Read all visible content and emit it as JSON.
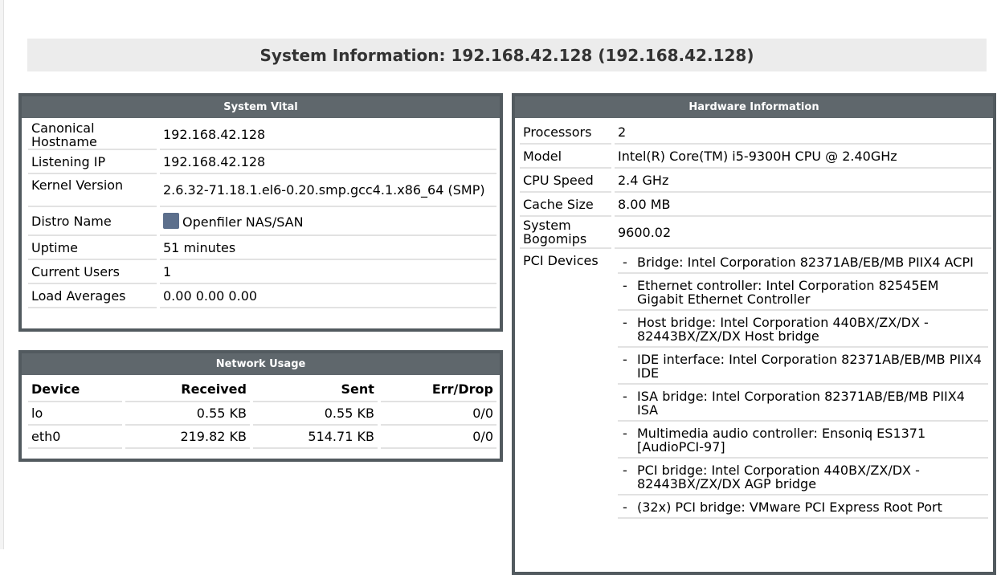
{
  "page": {
    "title": "System Information: 192.168.42.128 (192.168.42.128)"
  },
  "vital": {
    "header": "System Vital",
    "rows": [
      {
        "key": "Canonical Hostname",
        "value": "192.168.42.128"
      },
      {
        "key": "Listening IP",
        "value": "192.168.42.128"
      },
      {
        "key": "Kernel Version",
        "value": "2.6.32-71.18.1.el6-0.20.smp.gcc4.1.x86_64 (SMP)"
      },
      {
        "key": "Distro Name",
        "value": "Openfiler NAS/SAN",
        "icon": "distro-icon"
      },
      {
        "key": "Uptime",
        "value": "51 minutes"
      },
      {
        "key": "Current Users",
        "value": "1"
      },
      {
        "key": "Load Averages",
        "value": "0.00 0.00 0.00"
      }
    ]
  },
  "network": {
    "header": "Network Usage",
    "columns": [
      "Device",
      "Received",
      "Sent",
      "Err/Drop"
    ],
    "rows": [
      {
        "device": "lo",
        "received": "0.55 KB",
        "sent": "0.55 KB",
        "errdrop": "0/0"
      },
      {
        "device": "eth0",
        "received": "219.82 KB",
        "sent": "514.71 KB",
        "errdrop": "0/0"
      }
    ]
  },
  "hardware": {
    "header": "Hardware Information",
    "rows": [
      {
        "key": "Processors",
        "value": "2"
      },
      {
        "key": "Model",
        "value": "Intel(R) Core(TM) i5-9300H CPU @ 2.40GHz"
      },
      {
        "key": "CPU Speed",
        "value": "2.4 GHz"
      },
      {
        "key": "Cache Size",
        "value": "8.00 MB"
      },
      {
        "key": "System Bogomips",
        "value": "9600.02"
      }
    ],
    "pci_label": "PCI Devices",
    "pci_devices": [
      "Bridge: Intel Corporation 82371AB/EB/MB PIIX4 ACPI",
      "Ethernet controller: Intel Corporation 82545EM Gigabit Ethernet Controller",
      "Host bridge: Intel Corporation 440BX/ZX/DX - 82443BX/ZX/DX Host bridge",
      "IDE interface: Intel Corporation 82371AB/EB/MB PIIX4 IDE",
      "ISA bridge: Intel Corporation 82371AB/EB/MB PIIX4 ISA",
      "Multimedia audio controller: Ensoniq ES1371 [AudioPCI-97]",
      "PCI bridge: Intel Corporation 440BX/ZX/DX - 82443BX/ZX/DX AGP bridge",
      "(32x) PCI bridge: VMware PCI Express Root Port"
    ]
  }
}
